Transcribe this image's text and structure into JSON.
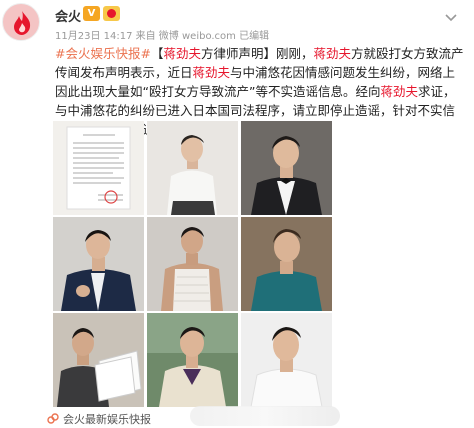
{
  "header": {
    "username": "会火",
    "vip_badge": "V",
    "meta_text": "11月23日 14:17 来自 微博 weibo.com   已编辑"
  },
  "post": {
    "hashtag": "#会火娱乐快报#",
    "bracket_open": "【",
    "name_1": "蒋劲夫",
    "title_rest": "方律师声明】刚刚，",
    "name_2": "蒋劲夫",
    "seg_1": "方就殴打女方致流产传闻发布声明表示，近日",
    "name_3": "蒋劲夫",
    "seg_2": "与中浦悠花因情感问题发生纠纷，网络上因此出现大量如“殴打女方导致流产”等不实造谣信息。经向",
    "name_4": "蒋劲夫",
    "seg_3": "求证，与中浦悠花的纠纷已进入日本国司法程序，请立即停止造谣，针对不实信息发布者将依法追责。"
  },
  "images": [
    {
      "name": "photo-legal-statement"
    },
    {
      "name": "photo-white-shirt"
    },
    {
      "name": "photo-vest-bowtie"
    },
    {
      "name": "photo-navy-suit"
    },
    {
      "name": "photo-tank-top"
    },
    {
      "name": "photo-teal-shirt"
    },
    {
      "name": "photo-reading-papers"
    },
    {
      "name": "photo-sweater-outdoor"
    },
    {
      "name": "photo-white-tee"
    }
  ],
  "footer": {
    "source": "会火最新娱乐快报"
  },
  "colors": {
    "hashtag": "#eb7350",
    "highlight": "#e6162d",
    "meta": "#999999"
  }
}
